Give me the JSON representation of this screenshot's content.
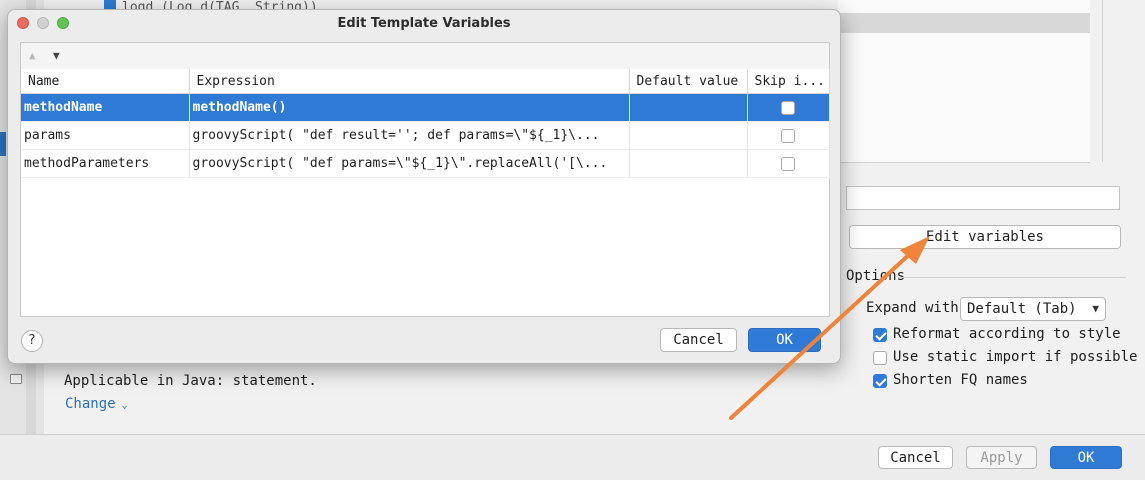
{
  "background": {
    "top_item": "logd (Log.d(TAG, String))",
    "edit_variables_label": "Edit variables",
    "options_label": "Options",
    "expand_with_label": "Expand with",
    "expand_with_value": "Default (Tab)",
    "options": [
      {
        "label": "Reformat according to style",
        "checked": true
      },
      {
        "label": "Use static import if possible",
        "checked": false
      },
      {
        "label": "Shorten FQ names",
        "checked": true
      }
    ],
    "applicable_text": "Applicable in Java: statement.",
    "change_link": "Change",
    "buttons": {
      "cancel": "Cancel",
      "apply": "Apply",
      "ok": "OK"
    }
  },
  "dialog": {
    "title": "Edit Template Variables",
    "columns": [
      "Name",
      "Expression",
      "Default value",
      "Skip i..."
    ],
    "rows": [
      {
        "name": "methodName",
        "expression": "methodName()",
        "default": "",
        "skip": false,
        "selected": true
      },
      {
        "name": "params",
        "expression": "groovyScript(  \"def result='';  def params=\\\"${_1}\\...",
        "default": "",
        "skip": false,
        "selected": false
      },
      {
        "name": "methodParameters",
        "expression": "groovyScript(  \"def params=\\\"${_1}\\\".replaceAll('[\\...",
        "default": "",
        "skip": false,
        "selected": false
      }
    ],
    "help": "?",
    "cancel_label": "Cancel",
    "ok_label": "OK"
  },
  "colors": {
    "accent": "#2f7ad4",
    "annotation_arrow": "#f0823a"
  }
}
